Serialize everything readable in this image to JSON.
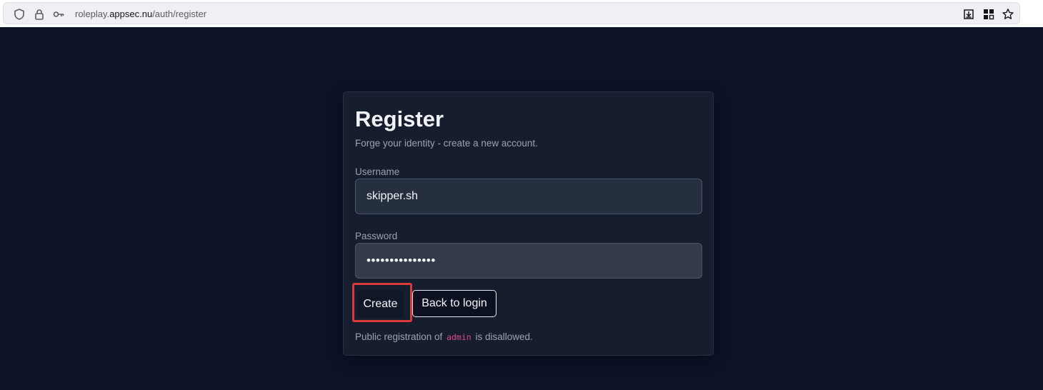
{
  "browser": {
    "url_scheme_host_prefix": "roleplay.",
    "url_host": "appsec.nu",
    "url_path": "/auth/register",
    "icons": [
      "shield-icon",
      "lock-icon",
      "key-icon",
      "download-icon",
      "extensions-icon",
      "star-icon"
    ]
  },
  "form": {
    "title": "Register",
    "subtitle": "Forge your identity - create a new account.",
    "username_label": "Username",
    "username_value": "skipper.sh",
    "password_label": "Password",
    "password_value": "•••••••••••••••",
    "create_label": "Create",
    "back_label": "Back to login",
    "note_before": "Public registration of",
    "note_code": "admin",
    "note_after": "is disallowed."
  },
  "colors": {
    "page_bg": "#0c1228",
    "card_bg": "#151d2e",
    "highlight": "#d93b3b",
    "code_accent": "#e0468f"
  }
}
